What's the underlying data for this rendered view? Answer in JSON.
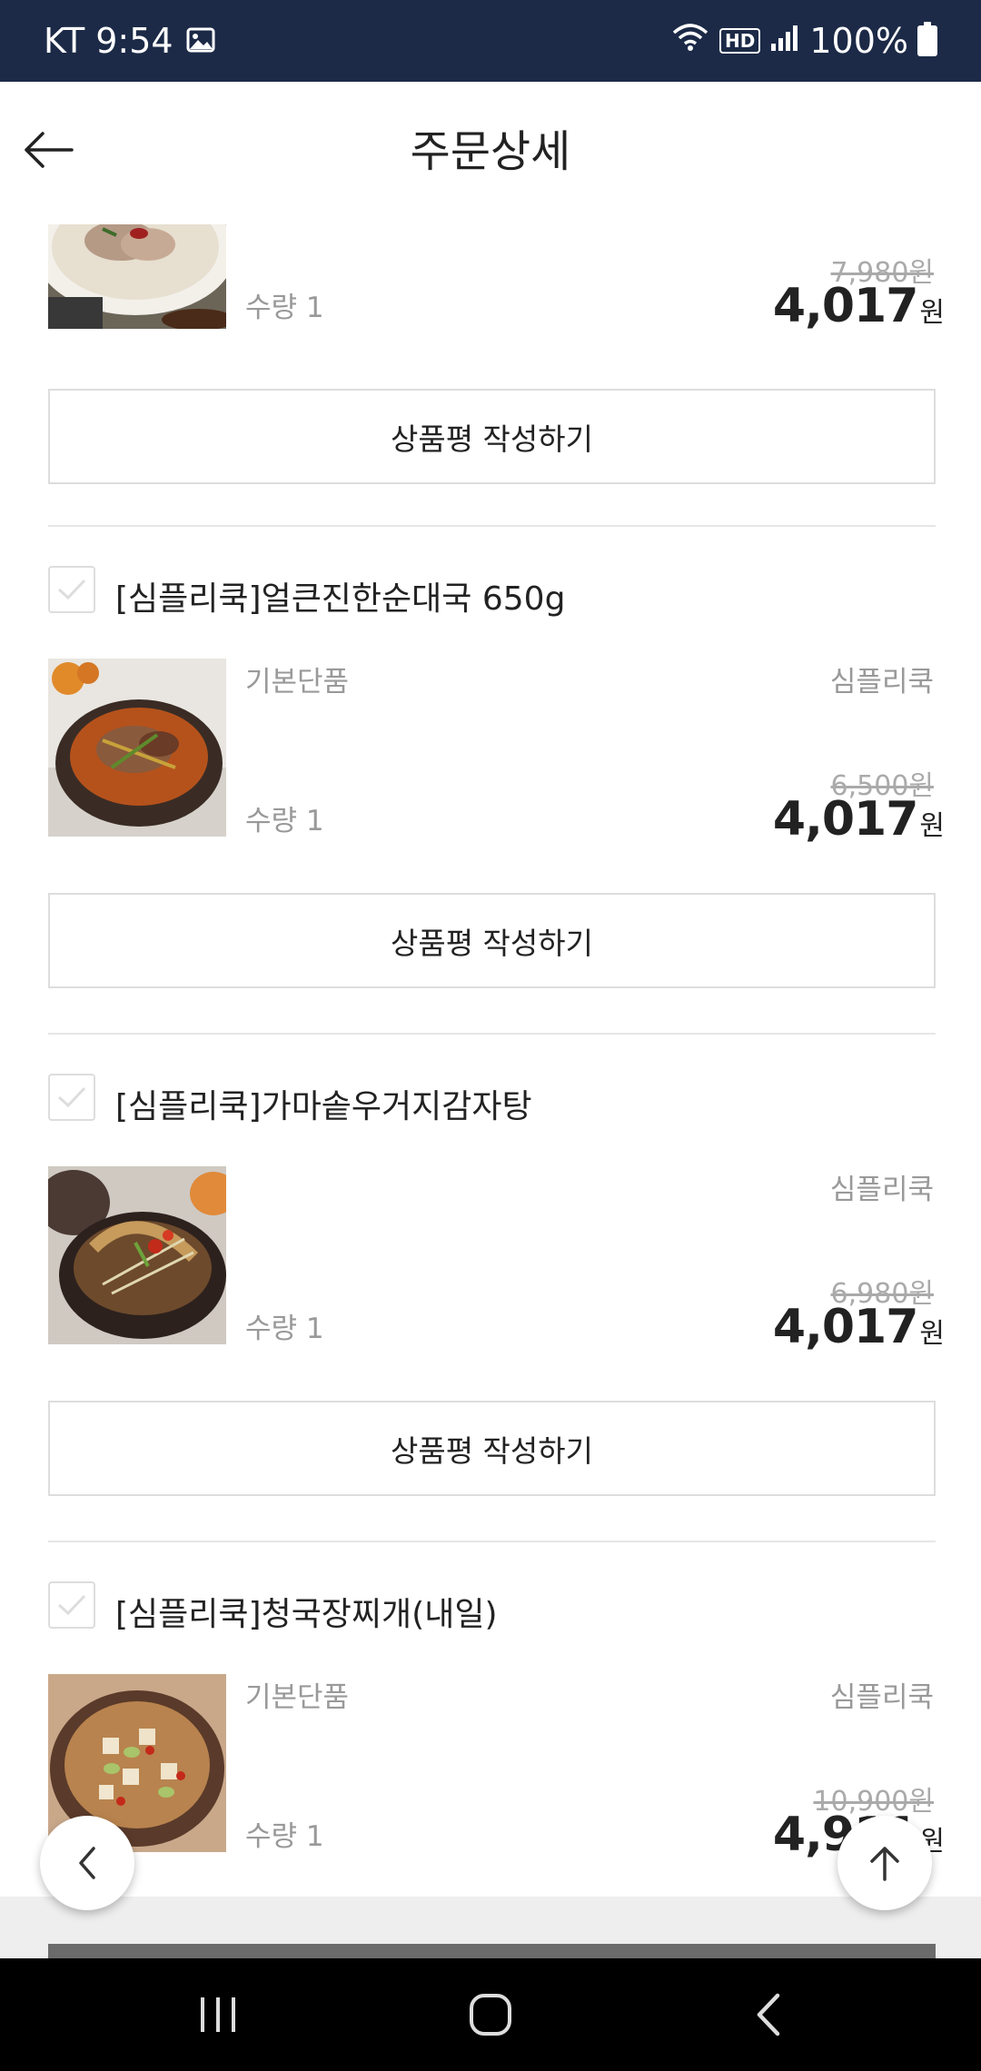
{
  "status_bar": {
    "carrier_time": "KT 9:54",
    "image_icon": "image-icon",
    "hd_label": "HD",
    "battery_text": "100%"
  },
  "header": {
    "back_icon": "arrow-left-icon",
    "title": "주문상세"
  },
  "items": [
    {
      "title": "",
      "option": "",
      "brand": "",
      "quantity": "수량 1",
      "original_price": "7,980원",
      "sale_price": "4,017",
      "currency_unit": "원",
      "review_label": "상품평 작성하기"
    },
    {
      "title": "[심플리쿡]얼큰진한순대국 650g",
      "option": "기본단품",
      "brand": "심플리쿡",
      "quantity": "수량 1",
      "original_price": "6,500원",
      "sale_price": "4,017",
      "currency_unit": "원",
      "review_label": "상품평 작성하기"
    },
    {
      "title": "[심플리쿡]가마솥우거지감자탕",
      "option": "",
      "brand": "심플리쿡",
      "quantity": "수량 1",
      "original_price": "6,980원",
      "sale_price": "4,017",
      "currency_unit": "원",
      "review_label": "상품평 작성하기"
    },
    {
      "title": "[심플리쿡]청국장찌개(내일)",
      "option": "기본단품",
      "brand": "심플리쿡",
      "quantity": "수량 1",
      "original_price": "10,900원",
      "sale_price": "4,911",
      "currency_unit": "원"
    }
  ],
  "floating": {
    "prev_icon": "chevron-left-icon",
    "top_icon": "arrow-up-icon"
  },
  "nav_bar": {
    "recents_icon": "recent-apps-icon",
    "home_icon": "home-icon",
    "back_icon": "back-icon"
  },
  "colors": {
    "status_bar_bg": "#1c2a47",
    "text_primary": "#222222",
    "text_muted": "#999999",
    "border": "#dddddd"
  }
}
